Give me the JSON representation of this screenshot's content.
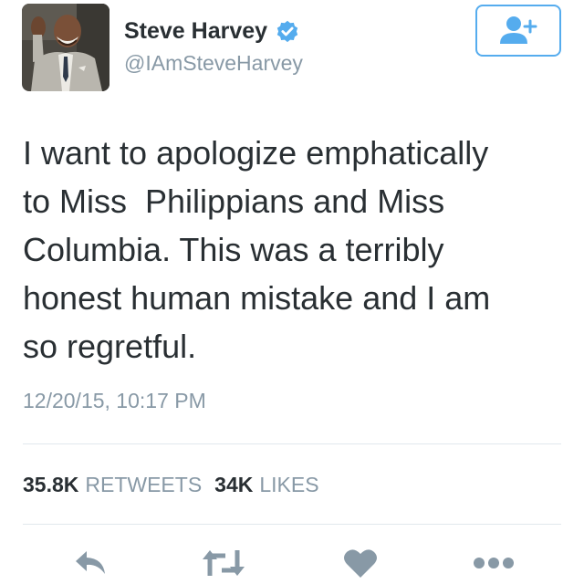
{
  "user": {
    "name": "Steve Harvey",
    "handle": "@IAmSteveHarvey",
    "verified": true
  },
  "tweet": {
    "text": "I want to apologize emphatically\nto Miss  Philippians and Miss\nColumbia. This was a terribly\nhonest human mistake and I am\nso regretful.",
    "timestamp": "12/20/15, 10:17 PM"
  },
  "stats": {
    "retweets_count": "35.8K",
    "retweets_label": "RETWEETS",
    "likes_count": "34K",
    "likes_label": "LIKES"
  },
  "icons": {
    "follow": "follow-user-icon",
    "reply": "reply-icon",
    "retweet": "retweet-icon",
    "like": "heart-icon",
    "more": "more-icon",
    "verified": "verified-badge-icon"
  },
  "colors": {
    "accent": "#55acee",
    "text": "#292f33",
    "muted": "#8899a6",
    "action_icon": "#8899a6",
    "divider": "#e1e8ed"
  }
}
